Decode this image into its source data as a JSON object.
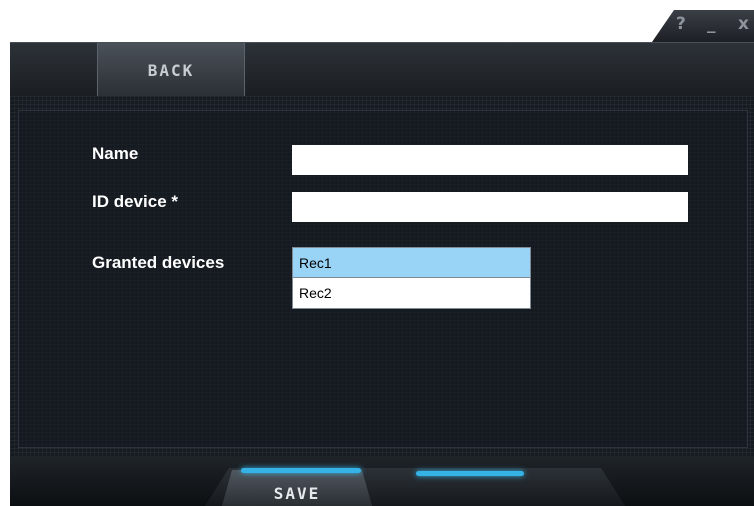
{
  "window_controls": {
    "help": "?",
    "minimize": "_",
    "close": "x"
  },
  "header": {
    "back_label": "BACK"
  },
  "form": {
    "name_label": "Name",
    "name_value": "",
    "id_label": "ID device *",
    "id_value": "",
    "granted_label": "Granted devices",
    "granted_devices": [
      {
        "label": "Rec1",
        "selected": true
      },
      {
        "label": "Rec2",
        "selected": false
      }
    ]
  },
  "footer": {
    "save_label": "SAVE"
  },
  "colors": {
    "accent": "#35b2e6",
    "selection": "#99d3f6",
    "panel": "#161b21"
  }
}
